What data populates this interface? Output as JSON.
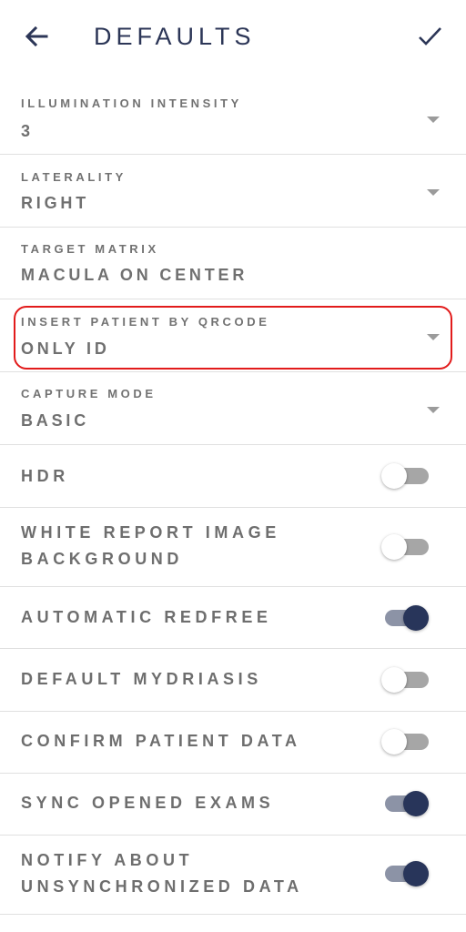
{
  "header": {
    "title": "DEFAULTS",
    "back_icon": "arrow-left-icon",
    "confirm_icon": "check-icon"
  },
  "selects": [
    {
      "label": "ILLUMINATION INTENSITY",
      "value": "3"
    },
    {
      "label": "LATERALITY",
      "value": "RIGHT"
    },
    {
      "label": "TARGET MATRIX",
      "value": "MACULA ON CENTER"
    },
    {
      "label": "INSERT PATIENT BY QRCODE",
      "value": "ONLY ID"
    },
    {
      "label": "CAPTURE MODE",
      "value": "BASIC"
    }
  ],
  "toggles": [
    {
      "label": "HDR",
      "on": false
    },
    {
      "label": "WHITE REPORT IMAGE BACKGROUND",
      "on": false
    },
    {
      "label": "AUTOMATIC REDFREE",
      "on": true
    },
    {
      "label": "DEFAULT MYDRIASIS",
      "on": false
    },
    {
      "label": "CONFIRM PATIENT DATA",
      "on": false
    },
    {
      "label": "SYNC OPENED EXAMS",
      "on": true
    },
    {
      "label": "NOTIFY ABOUT UNSYNCHRONIZED DATA",
      "on": true
    }
  ],
  "colors": {
    "accent": "#28355a",
    "highlight": "#e21b1b"
  }
}
